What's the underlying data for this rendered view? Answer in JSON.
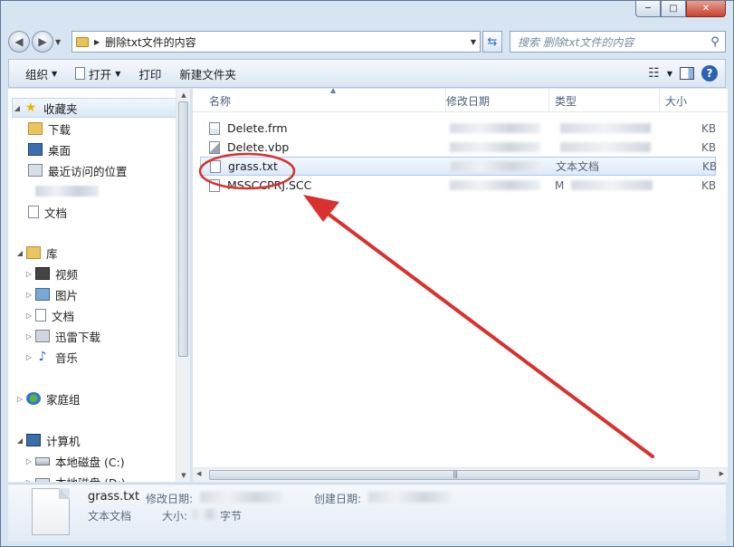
{
  "window": {
    "caption_minimize": "─",
    "caption_maximize": "□",
    "caption_close": "✕"
  },
  "address": {
    "path": "删除txt文件的内容",
    "search_placeholder": "搜索 删除txt文件的内容"
  },
  "toolbar": {
    "organize": "组织",
    "open": "打开",
    "print": "打印",
    "new_folder": "新建文件夹"
  },
  "nav": {
    "favorites": "收藏夹",
    "downloads": "下载",
    "desktop": "桌面",
    "recent": "最近访问的位置",
    "documents_fav": "文档",
    "libraries": "库",
    "videos": "视频",
    "pictures": "图片",
    "documents": "文档",
    "thunder": "迅雷下载",
    "music": "音乐",
    "homegroup": "家庭组",
    "computer": "计算机",
    "drive_c": "本地磁盘 (C:)",
    "drive_d": "本地磁盘 (D:)"
  },
  "columns": {
    "name": "名称",
    "modified": "修改日期",
    "type": "类型",
    "size": "大小"
  },
  "files": [
    {
      "name": "Delete.frm",
      "type": "",
      "size": "KB"
    },
    {
      "name": "Delete.vbp",
      "type": "",
      "size": "KB"
    },
    {
      "name": "grass.txt",
      "type": "文本文档",
      "size": "KB"
    },
    {
      "name": "MSSCCPRJ.SCC",
      "type": "M",
      "size": "KB"
    }
  ],
  "details": {
    "name": "grass.txt",
    "modified_label": "修改日期:",
    "created_label": "创建日期:",
    "type": "文本文档",
    "size_label": "大小:",
    "size_unit": "字节"
  },
  "annotation_color": "#d9312f"
}
